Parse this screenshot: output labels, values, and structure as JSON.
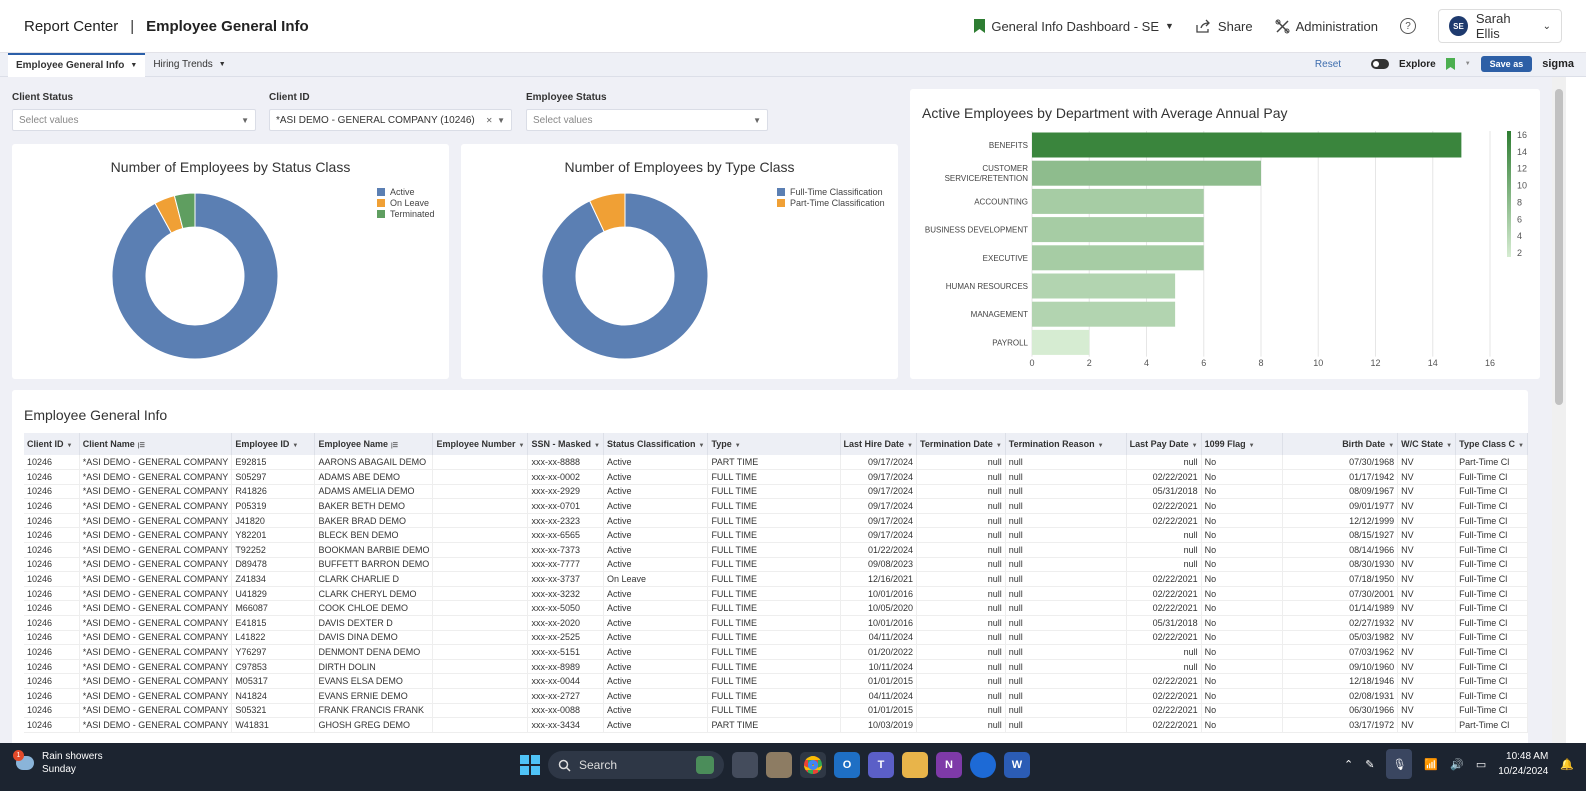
{
  "header": {
    "brand": "Report Center",
    "separator": "|",
    "page_title": "Employee General Info",
    "dashboard_label": "General Info Dashboard - SE",
    "share_label": "Share",
    "admin_label": "Administration",
    "user_initials": "SE",
    "user_name": "Sarah Ellis",
    "accent_color": "#2e7d32"
  },
  "tabs": {
    "items": [
      {
        "label": "Employee General Info"
      },
      {
        "label": "Hiring Trends"
      }
    ],
    "reset_label": "Reset",
    "explore_label": "Explore",
    "saveas_label": "Save as",
    "sigma_label": "sigma"
  },
  "filters": {
    "client_status": {
      "label": "Client Status",
      "placeholder": "Select values"
    },
    "client_id": {
      "label": "Client ID",
      "value": "*ASI DEMO - GENERAL COMPANY (10246)"
    },
    "employee_status": {
      "label": "Employee Status",
      "placeholder": "Select values"
    }
  },
  "chart_data": [
    {
      "type": "pie",
      "title": "Number of Employees by Status Class",
      "categories": [
        "Active",
        "On Leave",
        "Terminated"
      ],
      "values": [
        92,
        4,
        4
      ],
      "colors": [
        "#5b7fb3",
        "#f0a035",
        "#5f9e60"
      ]
    },
    {
      "type": "pie",
      "title": "Number of Employees by Type Class",
      "categories": [
        "Full-Time Classification",
        "Part-Time Classification"
      ],
      "values": [
        93,
        7
      ],
      "colors": [
        "#5b7fb3",
        "#f0a035"
      ]
    },
    {
      "type": "bar",
      "orientation": "horizontal",
      "title": "Active Employees by Department with Average Annual Pay",
      "categories": [
        "BENEFITS",
        "CUSTOMER SERVICE/RETENTION",
        "ACCOUNTING",
        "BUSINESS DEVELOPMENT",
        "EXECUTIVE",
        "HUMAN RESOURCES",
        "MANAGEMENT",
        "PAYROLL"
      ],
      "values": [
        15,
        8,
        6,
        6,
        6,
        5,
        5,
        2
      ],
      "xlim": [
        0,
        16
      ],
      "xticks": [
        "0",
        "2",
        "4",
        "6",
        "8",
        "10",
        "12",
        "14",
        "16"
      ],
      "colorbar_ticks": [
        "16",
        "14",
        "12",
        "10",
        "8",
        "6",
        "4",
        "2"
      ],
      "color_low": "#d6ecd2",
      "color_high": "#2e7d32"
    }
  ],
  "table": {
    "title": "Employee General Info",
    "columns": [
      "Client ID",
      "Client Name",
      "Employee ID",
      "Employee Name",
      "Employee Number",
      "SSN - Masked",
      "Status Classification",
      "Type",
      "Last Hire Date",
      "Termination Date",
      "Termination Reason",
      "Last Pay Date",
      "1099 Flag",
      "Birth Date",
      "W/C State",
      "Type Class C"
    ],
    "rows": [
      [
        "10246",
        "*ASI DEMO - GENERAL COMPANY",
        "E92815",
        "AARONS ABAGAIL DEMO",
        "",
        "xxx-xx-8888",
        "Active",
        "PART TIME",
        "09/17/2024",
        "null",
        "null",
        "null",
        "No",
        "07/30/1968",
        "NV",
        "Part-Time Cl"
      ],
      [
        "10246",
        "*ASI DEMO - GENERAL COMPANY",
        "S05297",
        "ADAMS ABE DEMO",
        "",
        "xxx-xx-0002",
        "Active",
        "FULL TIME",
        "09/17/2024",
        "null",
        "null",
        "02/22/2021",
        "No",
        "01/17/1942",
        "NV",
        "Full-Time Cl"
      ],
      [
        "10246",
        "*ASI DEMO - GENERAL COMPANY",
        "R41826",
        "ADAMS AMELIA DEMO",
        "",
        "xxx-xx-2929",
        "Active",
        "FULL TIME",
        "09/17/2024",
        "null",
        "null",
        "05/31/2018",
        "No",
        "08/09/1967",
        "NV",
        "Full-Time Cl"
      ],
      [
        "10246",
        "*ASI DEMO - GENERAL COMPANY",
        "P05319",
        "BAKER BETH DEMO",
        "",
        "xxx-xx-0701",
        "Active",
        "FULL TIME",
        "09/17/2024",
        "null",
        "null",
        "02/22/2021",
        "No",
        "09/01/1977",
        "NV",
        "Full-Time Cl"
      ],
      [
        "10246",
        "*ASI DEMO - GENERAL COMPANY",
        "J41820",
        "BAKER BRAD DEMO",
        "",
        "xxx-xx-2323",
        "Active",
        "FULL TIME",
        "09/17/2024",
        "null",
        "null",
        "02/22/2021",
        "No",
        "12/12/1999",
        "NV",
        "Full-Time Cl"
      ],
      [
        "10246",
        "*ASI DEMO - GENERAL COMPANY",
        "Y82201",
        "BLECK BEN DEMO",
        "",
        "xxx-xx-6565",
        "Active",
        "FULL TIME",
        "09/17/2024",
        "null",
        "null",
        "null",
        "No",
        "08/15/1927",
        "NV",
        "Full-Time Cl"
      ],
      [
        "10246",
        "*ASI DEMO - GENERAL COMPANY",
        "T92252",
        "BOOKMAN BARBIE DEMO",
        "",
        "xxx-xx-7373",
        "Active",
        "FULL TIME",
        "01/22/2024",
        "null",
        "null",
        "null",
        "No",
        "08/14/1966",
        "NV",
        "Full-Time Cl"
      ],
      [
        "10246",
        "*ASI DEMO - GENERAL COMPANY",
        "D89478",
        "BUFFETT BARRON DEMO",
        "",
        "xxx-xx-7777",
        "Active",
        "FULL TIME",
        "09/08/2023",
        "null",
        "null",
        "null",
        "No",
        "08/30/1930",
        "NV",
        "Full-Time Cl"
      ],
      [
        "10246",
        "*ASI DEMO - GENERAL COMPANY",
        "Z41834",
        "CLARK CHARLIE D",
        "",
        "xxx-xx-3737",
        "On Leave",
        "FULL TIME",
        "12/16/2021",
        "null",
        "null",
        "02/22/2021",
        "No",
        "07/18/1950",
        "NV",
        "Full-Time Cl"
      ],
      [
        "10246",
        "*ASI DEMO - GENERAL COMPANY",
        "U41829",
        "CLARK CHERYL DEMO",
        "",
        "xxx-xx-3232",
        "Active",
        "FULL TIME",
        "10/01/2016",
        "null",
        "null",
        "02/22/2021",
        "No",
        "07/30/2001",
        "NV",
        "Full-Time Cl"
      ],
      [
        "10246",
        "*ASI DEMO - GENERAL COMPANY",
        "M66087",
        "COOK CHLOE DEMO",
        "",
        "xxx-xx-5050",
        "Active",
        "FULL TIME",
        "10/05/2020",
        "null",
        "null",
        "02/22/2021",
        "No",
        "01/14/1989",
        "NV",
        "Full-Time Cl"
      ],
      [
        "10246",
        "*ASI DEMO - GENERAL COMPANY",
        "E41815",
        "DAVIS DEXTER D",
        "",
        "xxx-xx-2020",
        "Active",
        "FULL TIME",
        "10/01/2016",
        "null",
        "null",
        "05/31/2018",
        "No",
        "02/27/1932",
        "NV",
        "Full-Time Cl"
      ],
      [
        "10246",
        "*ASI DEMO - GENERAL COMPANY",
        "L41822",
        "DAVIS DINA DEMO",
        "",
        "xxx-xx-2525",
        "Active",
        "FULL TIME",
        "04/11/2024",
        "null",
        "null",
        "02/22/2021",
        "No",
        "05/03/1982",
        "NV",
        "Full-Time Cl"
      ],
      [
        "10246",
        "*ASI DEMO - GENERAL COMPANY",
        "Y76297",
        "DENMONT DENA DEMO",
        "",
        "xxx-xx-5151",
        "Active",
        "FULL TIME",
        "01/20/2022",
        "null",
        "null",
        "null",
        "No",
        "07/03/1962",
        "NV",
        "Full-Time Cl"
      ],
      [
        "10246",
        "*ASI DEMO - GENERAL COMPANY",
        "C97853",
        "DIRTH DOLIN",
        "",
        "xxx-xx-8989",
        "Active",
        "FULL TIME",
        "10/11/2024",
        "null",
        "null",
        "null",
        "No",
        "09/10/1960",
        "NV",
        "Full-Time Cl"
      ],
      [
        "10246",
        "*ASI DEMO - GENERAL COMPANY",
        "M05317",
        "EVANS ELSA DEMO",
        "",
        "xxx-xx-0044",
        "Active",
        "FULL TIME",
        "01/01/2015",
        "null",
        "null",
        "02/22/2021",
        "No",
        "12/18/1946",
        "NV",
        "Full-Time Cl"
      ],
      [
        "10246",
        "*ASI DEMO - GENERAL COMPANY",
        "N41824",
        "EVANS ERNIE DEMO",
        "",
        "xxx-xx-2727",
        "Active",
        "FULL TIME",
        "04/11/2024",
        "null",
        "null",
        "02/22/2021",
        "No",
        "02/08/1931",
        "NV",
        "Full-Time Cl"
      ],
      [
        "10246",
        "*ASI DEMO - GENERAL COMPANY",
        "S05321",
        "FRANK FRANCIS FRANK",
        "",
        "xxx-xx-0088",
        "Active",
        "FULL TIME",
        "01/01/2015",
        "null",
        "null",
        "02/22/2021",
        "No",
        "06/30/1966",
        "NV",
        "Full-Time Cl"
      ],
      [
        "10246",
        "*ASI DEMO - GENERAL COMPANY",
        "W41831",
        "GHOSH GREG DEMO",
        "",
        "xxx-xx-3434",
        "Active",
        "PART TIME",
        "10/03/2019",
        "null",
        "null",
        "02/22/2021",
        "No",
        "03/17/1972",
        "NV",
        "Part-Time Cl"
      ]
    ]
  },
  "taskbar": {
    "weather_title": "Rain showers",
    "weather_sub": "Sunday",
    "weather_badge": "1",
    "search_label": "Search",
    "time": "10:48 AM",
    "date": "10/24/2024"
  }
}
